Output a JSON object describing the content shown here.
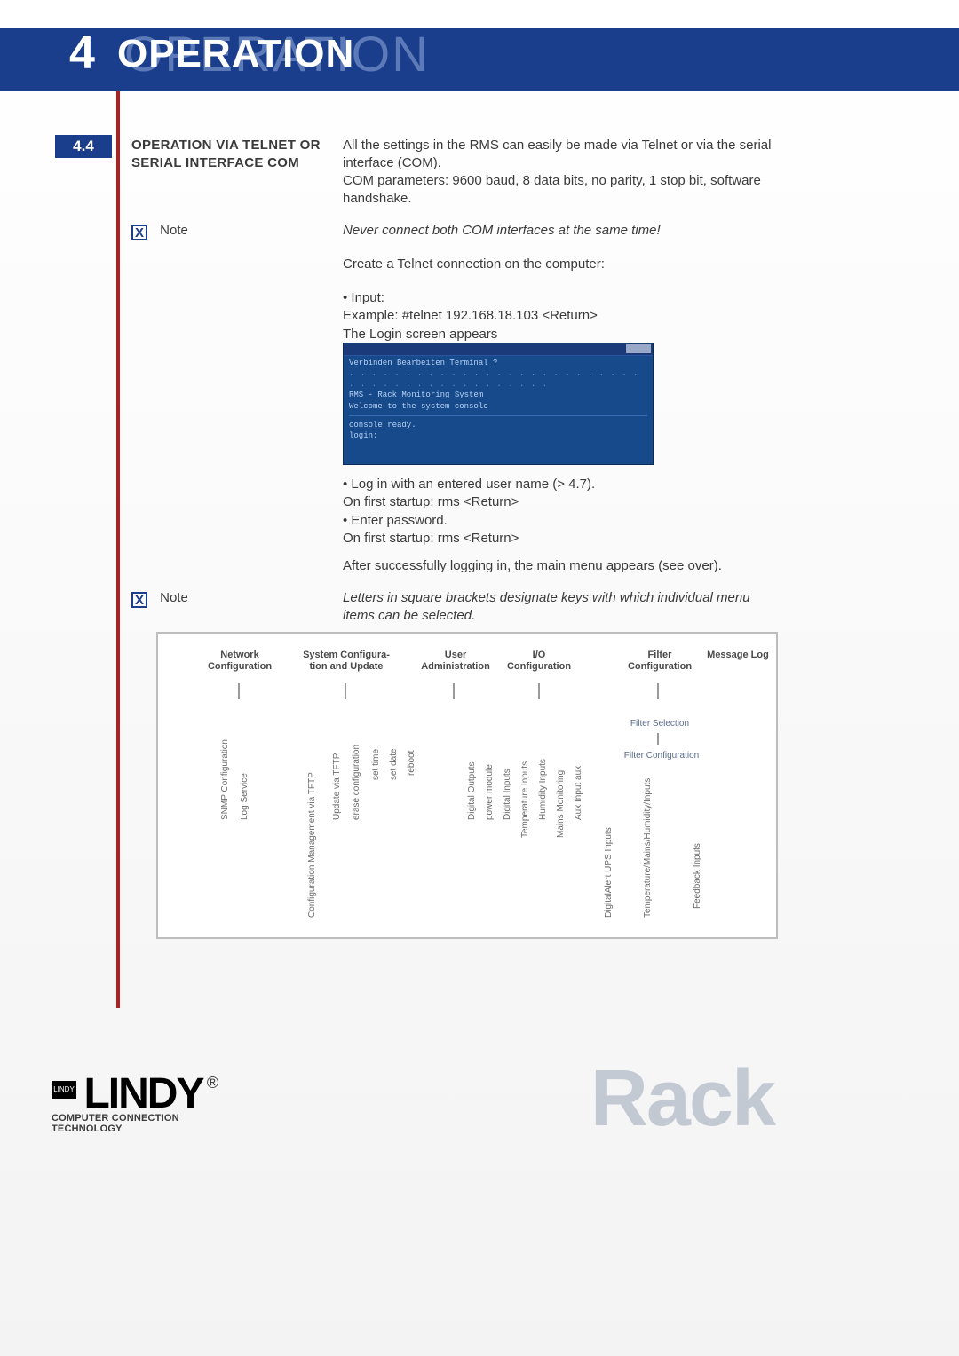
{
  "chapter": {
    "num": "4",
    "title_shadow": "OPERATION",
    "title": "OPERATION"
  },
  "section": {
    "num": "4.4",
    "heading": "OPERATION VIA TELNET OR SERIAL INTERFACE COM"
  },
  "body": {
    "intro1": "All the settings in the RMS can easily be made via Telnet or via the serial interface (COM).",
    "intro2": "COM parameters: 9600 baud, 8 data bits, no parity, 1 stop bit, software handshake.",
    "note1_label": "Note",
    "note1_text": "Never connect both COM interfaces at the same time!",
    "create": "Create a Telnet connection on the computer:",
    "input_bullet": "• Input:",
    "input_example": "Example: #telnet 192.168.18.103 <Return>",
    "input_appears": "The Login screen appears",
    "term": {
      "title_hint": "Telnet — RMS",
      "menu": "Verbinden  Bearbeiten  Terminal  ?",
      "line1": "RMS - Rack Monitoring System",
      "line2": "Welcome to the system console",
      "line3": "console ready.",
      "line4": "login:"
    },
    "login_bullet": "• Log in with an entered user name (> 4.7).",
    "login_first1": "On first startup: rms <Return>",
    "pwd_bullet": "• Enter password.",
    "login_first2": "On first startup: rms <Return>",
    "after": "After successfully logging in, the main menu appears (see over).",
    "note2_label": "Note",
    "note2_text": "Letters in square brackets designate keys with which individual menu items can be selected."
  },
  "diagram": {
    "top": {
      "network": "Network\nConfiguration",
      "system": "System Configura-\ntion and Update",
      "user": "User\nAdministration",
      "io": "I/O\nConfiguration",
      "filter": "Filter\nConfiguration",
      "msglog": "Message Log"
    },
    "network_children": [
      "SNMP Configuration",
      "Log Service"
    ],
    "system_children": [
      "Configuration Management via TFTP",
      "Update via TFTP",
      "erase configuration",
      "set time",
      "set date",
      "reboot"
    ],
    "io_children": [
      "Digital Outputs",
      "power module",
      "Digital Inputs",
      "Temperature Inputs",
      "Humidity Inputs",
      "Mains Monitoring",
      "Aux Input aux"
    ],
    "filter_step1": "Filter Selection",
    "filter_step2": "Filter Configuration",
    "filter_children": [
      "DigitalAlert UPS Inputs",
      "Temperature/Mains/Humidity/Inputs",
      "Feedback Inputs"
    ]
  },
  "footer": {
    "watermark": "Rack",
    "brand_badge": "LINDY",
    "brand": "LINDY",
    "reg": "®",
    "tagline": "COMPUTER CONNECTION TECHNOLOGY"
  }
}
